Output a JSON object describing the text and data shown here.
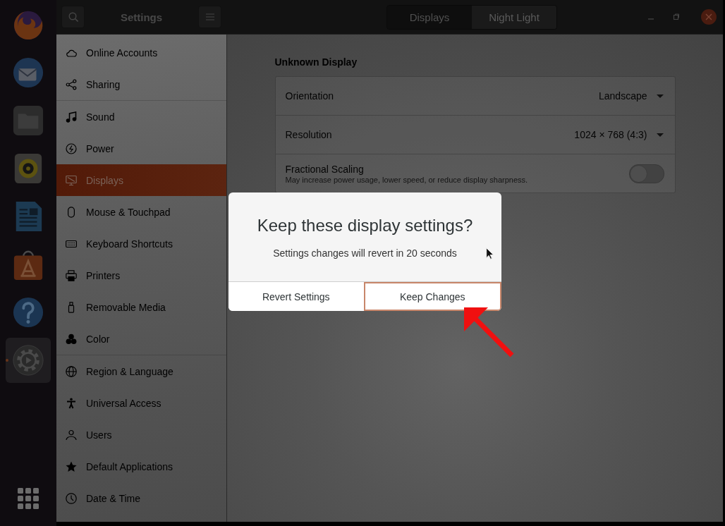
{
  "dock": [
    {
      "kind": "browser",
      "selected": false
    },
    {
      "kind": "mail",
      "selected": false
    },
    {
      "kind": "files",
      "selected": false
    },
    {
      "kind": "music",
      "selected": false
    },
    {
      "kind": "writer",
      "selected": false
    },
    {
      "kind": "store",
      "selected": false
    },
    {
      "kind": "help",
      "selected": false
    },
    {
      "kind": "settings",
      "selected": true
    }
  ],
  "header": {
    "title": "Settings",
    "tabs": [
      {
        "label": "Displays",
        "selected": true
      },
      {
        "label": "Night Light",
        "selected": false
      }
    ]
  },
  "sidebar": {
    "groups": [
      {
        "items": [
          {
            "label": "Online Accounts",
            "selected": false
          },
          {
            "label": "Sharing",
            "selected": false
          }
        ]
      },
      {
        "items": [
          {
            "label": "Sound",
            "selected": false
          },
          {
            "label": "Power",
            "selected": false
          },
          {
            "label": "Displays",
            "selected": true
          },
          {
            "label": "Mouse & Touchpad",
            "selected": false
          },
          {
            "label": "Keyboard Shortcuts",
            "selected": false
          },
          {
            "label": "Printers",
            "selected": false
          },
          {
            "label": "Removable Media",
            "selected": false
          },
          {
            "label": "Color",
            "selected": false
          }
        ]
      },
      {
        "items": [
          {
            "label": "Region & Language",
            "selected": false
          },
          {
            "label": "Universal Access",
            "selected": false
          },
          {
            "label": "Users",
            "selected": false
          },
          {
            "label": "Default Applications",
            "selected": false
          },
          {
            "label": "Date & Time",
            "selected": false
          }
        ]
      }
    ]
  },
  "content": {
    "section_title": "Unknown Display",
    "settings": [
      {
        "kind": "dropdown",
        "label": "Orientation",
        "value": "Landscape"
      },
      {
        "kind": "dropdown",
        "label": "Resolution",
        "value": "1024 × 768 (4:3)"
      },
      {
        "kind": "switch",
        "label": "Fractional Scaling",
        "description": "May increase power usage, lower speed, or reduce display sharpness.",
        "on": false
      }
    ]
  },
  "dialog": {
    "title": "Keep these display settings?",
    "message": "Settings changes will revert in 20 seconds",
    "buttons": [
      {
        "label": "Revert Settings",
        "focused": false
      },
      {
        "label": "Keep Changes",
        "focused": true
      }
    ]
  }
}
